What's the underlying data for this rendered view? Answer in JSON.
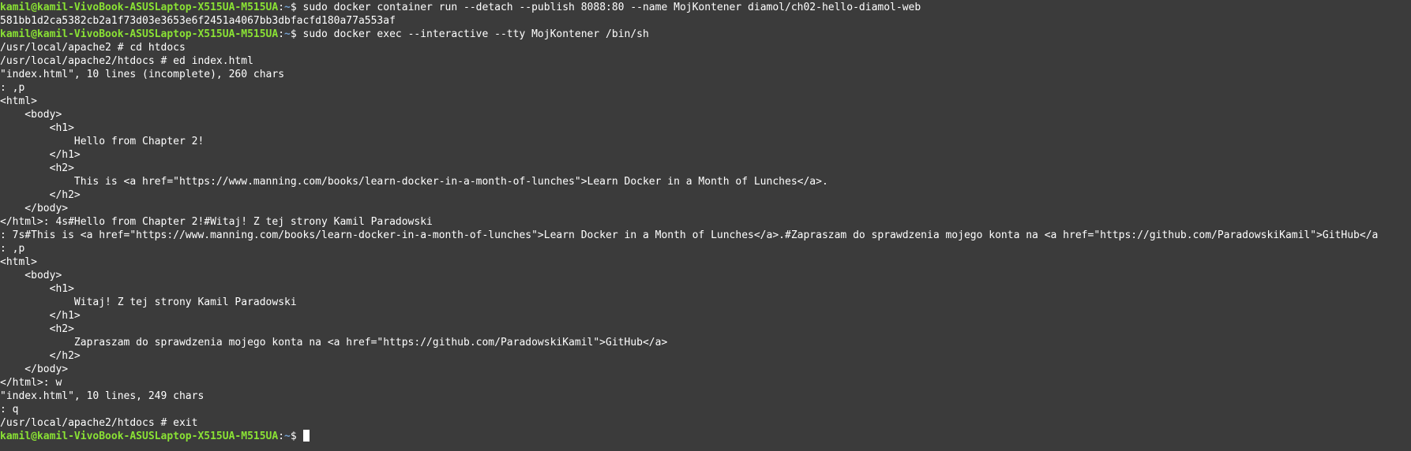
{
  "prompt": {
    "user_host": "kamil@kamil-VivoBook-ASUSLaptop-X515UA-M515UA",
    "path": "~",
    "sep": ":",
    "suffix": "$ "
  },
  "lines": [
    {
      "type": "prompt",
      "cmd": "sudo docker container run --detach --publish 8088:80 --name MojKontener diamol/ch02-hello-diamol-web"
    },
    {
      "type": "text",
      "text": "581bb1d2ca5382cb2a1f73d03e3653e6f2451a4067bb3dbfacfd180a77a553af"
    },
    {
      "type": "prompt",
      "cmd": "sudo docker exec --interactive --tty MojKontener /bin/sh"
    },
    {
      "type": "text",
      "text": "/usr/local/apache2 # cd htdocs"
    },
    {
      "type": "text",
      "text": "/usr/local/apache2/htdocs # ed index.html"
    },
    {
      "type": "text",
      "text": "\"index.html\", 10 lines (incomplete), 260 chars"
    },
    {
      "type": "text",
      "text": ": ,p"
    },
    {
      "type": "text",
      "text": "<html>"
    },
    {
      "type": "text",
      "text": "    <body>"
    },
    {
      "type": "text",
      "text": "        <h1>"
    },
    {
      "type": "text",
      "text": "            Hello from Chapter 2!"
    },
    {
      "type": "text",
      "text": "        </h1>"
    },
    {
      "type": "text",
      "text": "        <h2>"
    },
    {
      "type": "text",
      "text": "            This is <a href=\"https://www.manning.com/books/learn-docker-in-a-month-of-lunches\">Learn Docker in a Month of Lunches</a>."
    },
    {
      "type": "text",
      "text": "        </h2>"
    },
    {
      "type": "text",
      "text": "    </body>"
    },
    {
      "type": "text",
      "text": "</html>: 4s#Hello from Chapter 2!#Witaj! Z tej strony Kamil Paradowski"
    },
    {
      "type": "text",
      "text": ": 7s#This is <a href=\"https://www.manning.com/books/learn-docker-in-a-month-of-lunches\">Learn Docker in a Month of Lunches</a>.#Zapraszam do sprawdzenia mojego konta na <a href=\"https://github.com/ParadowskiKamil\">GitHub</a"
    },
    {
      "type": "text",
      "text": ": ,p"
    },
    {
      "type": "text",
      "text": "<html>"
    },
    {
      "type": "text",
      "text": "    <body>"
    },
    {
      "type": "text",
      "text": "        <h1>"
    },
    {
      "type": "text",
      "text": "            Witaj! Z tej strony Kamil Paradowski"
    },
    {
      "type": "text",
      "text": "        </h1>"
    },
    {
      "type": "text",
      "text": "        <h2>"
    },
    {
      "type": "text",
      "text": "            Zapraszam do sprawdzenia mojego konta na <a href=\"https://github.com/ParadowskiKamil\">GitHub</a>"
    },
    {
      "type": "text",
      "text": "        </h2>"
    },
    {
      "type": "text",
      "text": "    </body>"
    },
    {
      "type": "text",
      "text": "</html>: w"
    },
    {
      "type": "text",
      "text": "\"index.html\", 10 lines, 249 chars"
    },
    {
      "type": "text",
      "text": ": q"
    },
    {
      "type": "text",
      "text": "/usr/local/apache2/htdocs # exit"
    },
    {
      "type": "prompt",
      "cmd": "",
      "cursor": true
    }
  ],
  "colors": {
    "background": "#3b3b3b",
    "text": "#ffffff",
    "user_host": "#8ae234",
    "path": "#729fcf"
  }
}
